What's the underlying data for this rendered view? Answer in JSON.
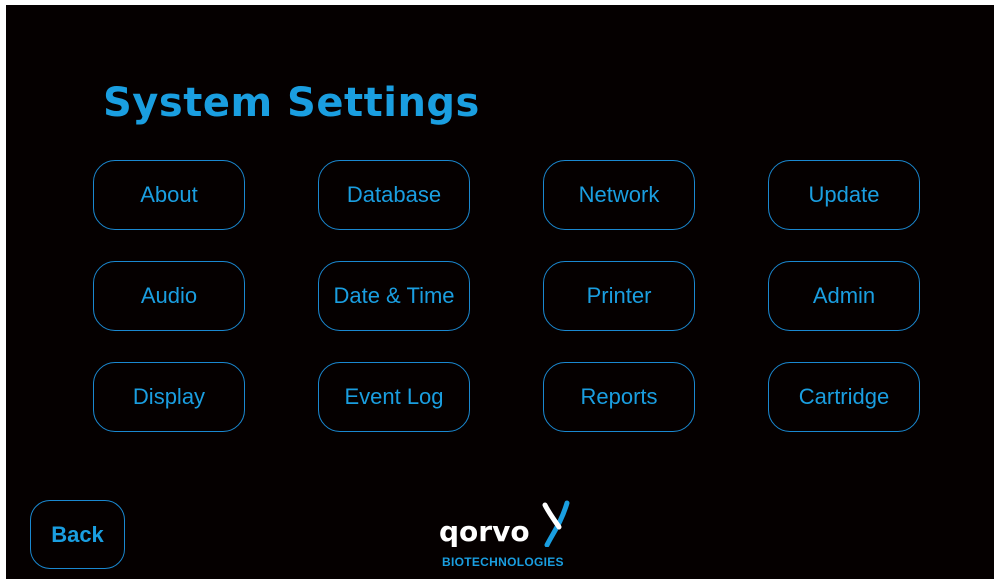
{
  "screen": {
    "title": "System Settings",
    "accent_color": "#1a9ee0",
    "background_color": "#050000"
  },
  "settings_buttons": [
    {
      "label": "About"
    },
    {
      "label": "Database"
    },
    {
      "label": "Network"
    },
    {
      "label": "Update"
    },
    {
      "label": "Audio"
    },
    {
      "label": "Date & Time"
    },
    {
      "label": "Printer"
    },
    {
      "label": "Admin"
    },
    {
      "label": "Display"
    },
    {
      "label": "Event Log"
    },
    {
      "label": "Reports"
    },
    {
      "label": "Cartridge"
    }
  ],
  "footer": {
    "back_label": "Back",
    "logo_word": "qorvo",
    "logo_sub": "BIOTECHNOLOGIES",
    "logo_icon": "dna-helix-icon"
  }
}
